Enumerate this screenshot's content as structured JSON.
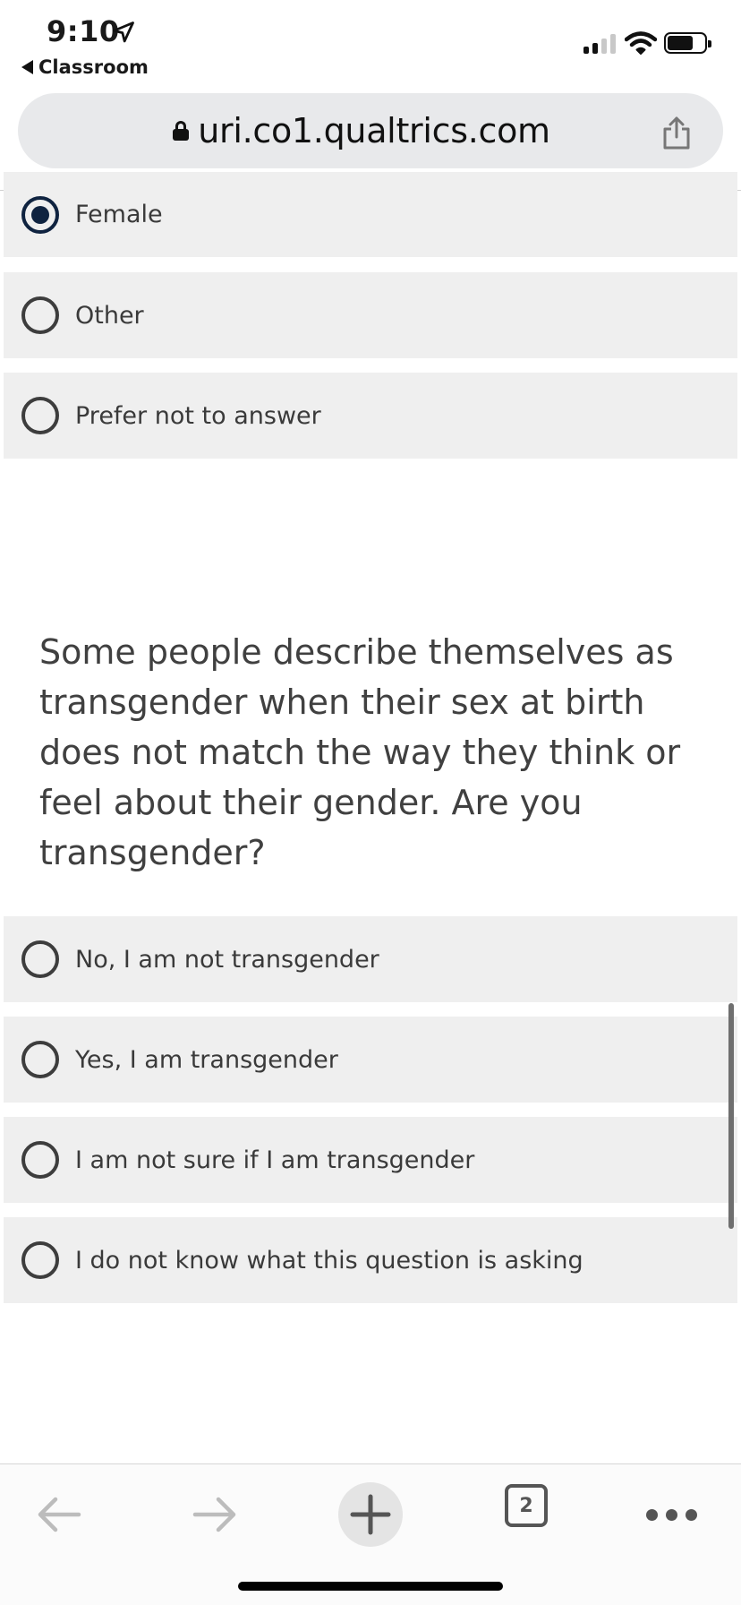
{
  "status_bar": {
    "time": "9:10",
    "back_app": "Classroom",
    "location_icon": "location-arrow-icon",
    "signal_icon": "cellular-signal-icon",
    "wifi_icon": "wifi-icon",
    "battery_icon": "battery-icon"
  },
  "browser": {
    "url": "uri.co1.qualtrics.com",
    "lock_icon": "lock-icon",
    "share_icon": "share-icon"
  },
  "q_prev": {
    "options": [
      {
        "label": "Female",
        "selected": true
      },
      {
        "label": "Other",
        "selected": false
      },
      {
        "label": "Prefer not to answer",
        "selected": false
      }
    ]
  },
  "q_trans": {
    "text": "Some people describe themselves as transgender when their sex at birth does not match the way they think or feel about their gender. Are you transgender?",
    "options": [
      {
        "label": "No, I am not transgender",
        "selected": false
      },
      {
        "label": "Yes, I am transgender",
        "selected": false
      },
      {
        "label": "I am not sure if I am transgender",
        "selected": false
      },
      {
        "label": "I do not know what this question is asking",
        "selected": false
      }
    ]
  },
  "toolbar": {
    "tab_count": "2",
    "icons": [
      "back-arrow-icon",
      "forward-arrow-icon",
      "plus-icon",
      "tabs-icon",
      "more-icon"
    ]
  }
}
